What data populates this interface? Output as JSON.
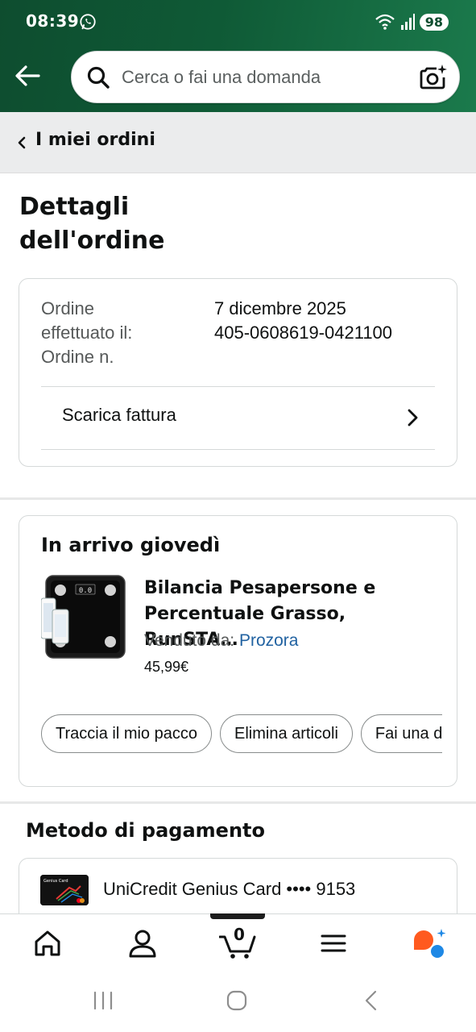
{
  "status_bar": {
    "time": "08:39",
    "battery": "98"
  },
  "search": {
    "placeholder": "Cerca o fai una domanda"
  },
  "breadcrumb": {
    "label": "I miei ordini"
  },
  "page": {
    "title_line1": "Dettagli",
    "title_line2": "dell'ordine"
  },
  "order_info": {
    "placed_label_1": "Ordine",
    "placed_label_2": "effettuato il:",
    "number_label": "Ordine n.",
    "placed_value": "7 dicembre 2025",
    "number_value": "405-0608619-0421100",
    "invoice_label": "Scarica fattura"
  },
  "shipment": {
    "heading": "In arrivo giovedì",
    "product_name_line1": "Bilancia Pesapersone e",
    "product_name_line2": "Percentuale Grasso, RunSTA…",
    "sold_by_label": "Venduto da:",
    "seller": "Prozora",
    "price": "45,99€",
    "thumb_display": "0.0",
    "actions": [
      "Traccia il mio pacco",
      "Elimina articoli",
      "Fai una domanda sul prodotto"
    ]
  },
  "payment": {
    "heading": "Metodo di pagamento",
    "card_name": "UniCredit Genius Card •••• 9153",
    "card_art_text": "Genius Card"
  },
  "bottom_nav": {
    "cart_count": "0"
  },
  "colors": {
    "header_green": "#0f5a36",
    "link_blue": "#2162a1",
    "rufus_orange": "#ff5a1f",
    "rufus_blue": "#1e88e5"
  },
  "icons": [
    "whatsapp-icon",
    "wifi-icon",
    "signal-icon",
    "back-arrow-icon",
    "search-icon",
    "camera-sparkle-icon",
    "chevron-left-icon",
    "chevron-right-icon",
    "home-icon",
    "account-icon",
    "cart-icon",
    "menu-icon",
    "rufus-icon"
  ]
}
